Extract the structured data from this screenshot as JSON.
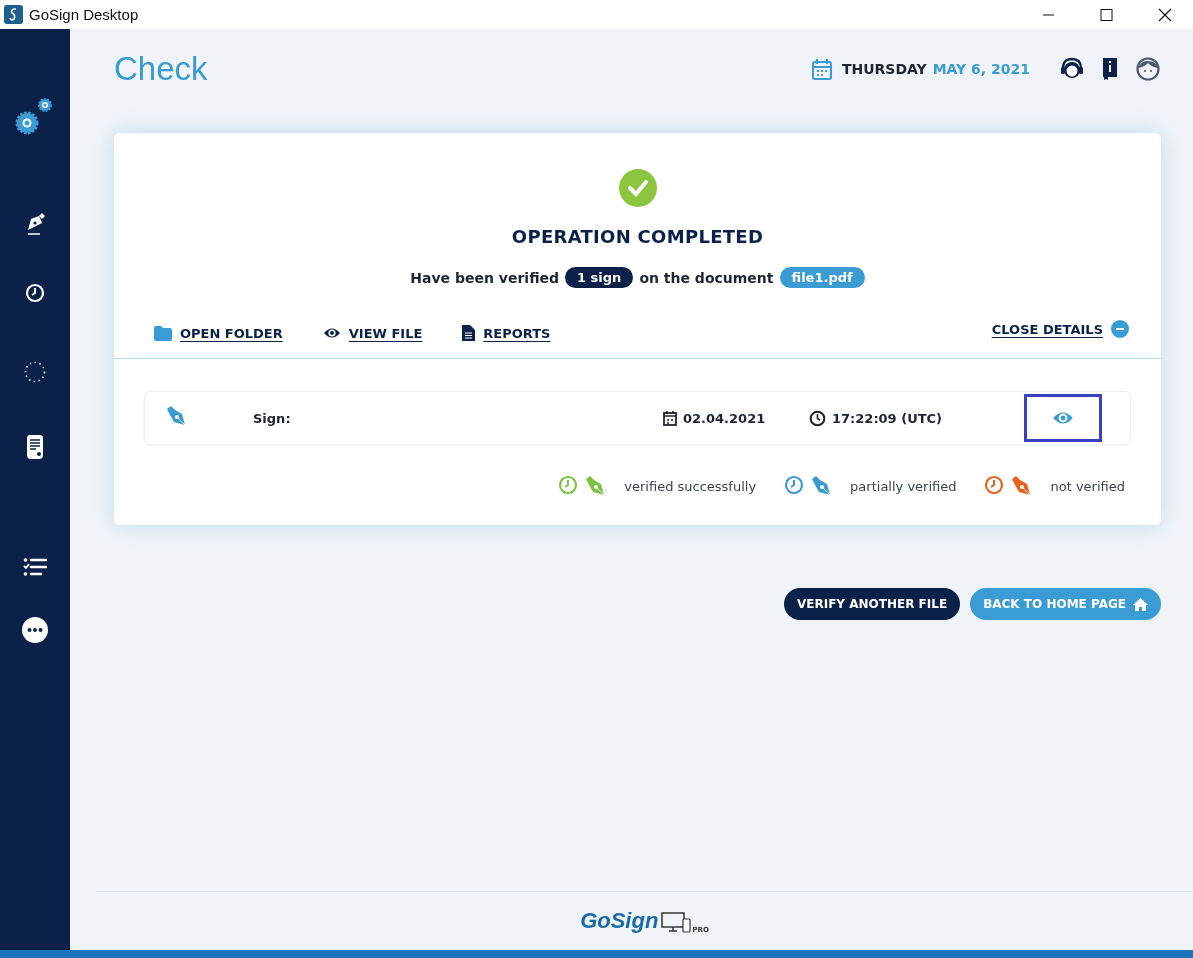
{
  "window": {
    "title": "GoSign Desktop"
  },
  "header": {
    "title": "Check",
    "weekday": "THURSDAY",
    "date": "MAY 6, 2021"
  },
  "result": {
    "heading": "OPERATION COMPLETED",
    "sentence_start": "Have been verified",
    "count_badge": "1 sign",
    "sentence_middle": "on the document",
    "file_badge": "file1.pdf"
  },
  "actions": [
    {
      "kind": "folder",
      "label": "OPEN FOLDER"
    },
    {
      "kind": "view",
      "label": "VIEW FILE"
    },
    {
      "kind": "report",
      "label": "REPORTS"
    }
  ],
  "close_details": "CLOSE DETAILS",
  "signatures": [
    {
      "kind": "partial",
      "label": "Sign:",
      "date": "02.04.2021",
      "time": "17:22:09 (UTC)",
      "view_focused": true
    }
  ],
  "legend": [
    {
      "label": "verified successfully",
      "color": "#7cc243"
    },
    {
      "label": "partially verified",
      "color": "#3a9bd5"
    },
    {
      "label": "not verified",
      "color": "#e8621c"
    }
  ],
  "buttons": [
    {
      "kind": "dark",
      "label": "VERIFY ANOTHER FILE"
    },
    {
      "kind": "home",
      "label": "BACK TO HOME PAGE"
    }
  ],
  "footer": {
    "logo": "GoSign",
    "badge": "PRO"
  }
}
